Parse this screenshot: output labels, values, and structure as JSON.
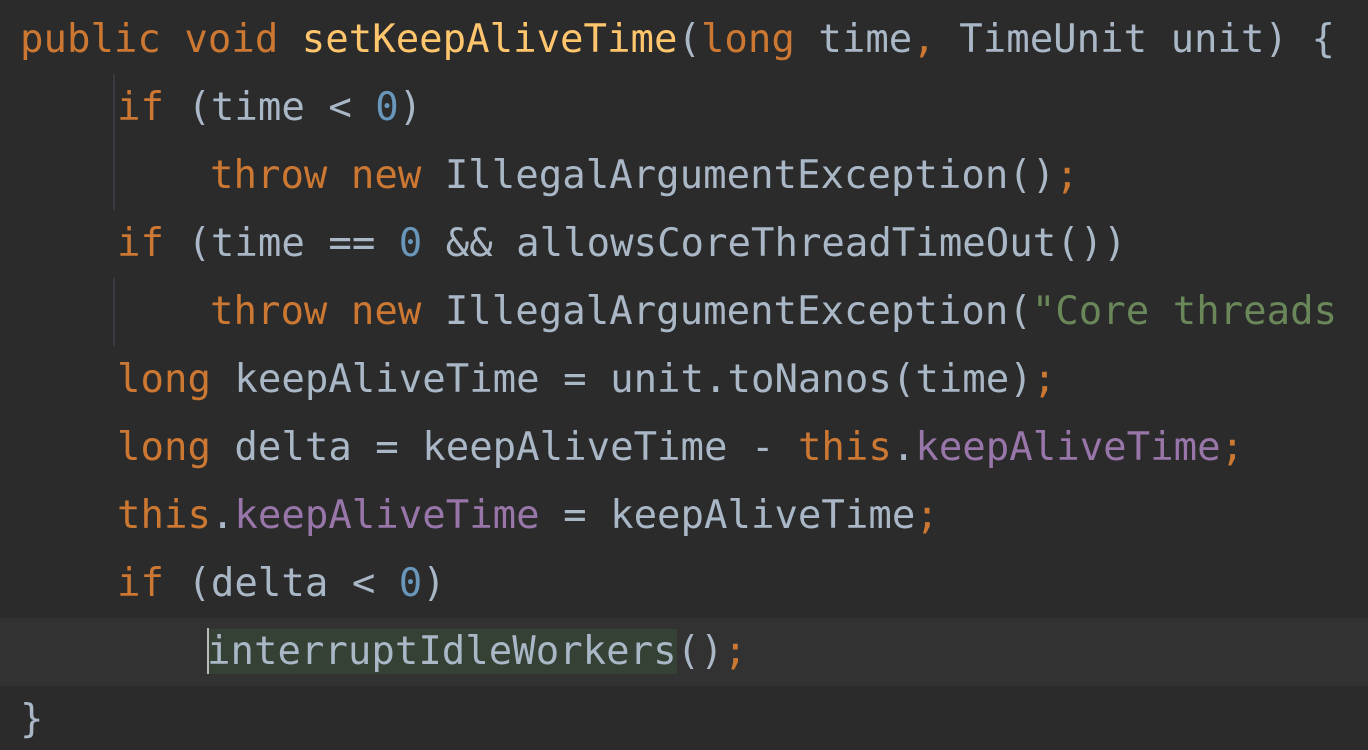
{
  "editor": {
    "language": "Java",
    "colors": {
      "background": "#2b2b2b",
      "current_line": "#323232",
      "keyword": "#cc7832",
      "method_declaration": "#ffc66d",
      "number": "#6897bb",
      "field": "#9876aa",
      "string": "#6a8759",
      "plain": "#a9b7c6",
      "usage_highlight": "#344134"
    },
    "lines": [
      {
        "tokens": {
          "public": "public",
          "void": "void",
          "name": "setKeepAliveTime",
          "paren_open": "(",
          "long": "long",
          "p1": "time",
          "comma": ",",
          "type": "TimeUnit",
          "p2": "unit",
          "close": ") {"
        }
      },
      {
        "tokens": {
          "if": "if",
          "cond_open": "(time < ",
          "zero": "0",
          "cond_close": ")"
        }
      },
      {
        "tokens": {
          "throw": "throw",
          "new": "new",
          "call": "IllegalArgumentException()",
          "semi": ";"
        }
      },
      {
        "tokens": {
          "if": "if",
          "cond_open": "(time == ",
          "zero": "0",
          "cond_rest": " && allowsCoreThreadTimeOut())"
        }
      },
      {
        "tokens": {
          "throw": "throw",
          "new": "new",
          "call": "IllegalArgumentException(",
          "string": "\"Core threads"
        }
      },
      {
        "tokens": {
          "long": "long",
          "rest": "keepAliveTime = unit.toNanos(time)",
          "semi": ";"
        }
      },
      {
        "tokens": {
          "long": "long",
          "rest": "delta = keepAliveTime - ",
          "this": "this",
          "dot": ".",
          "field": "keepAliveTime",
          "semi": ";"
        }
      },
      {
        "tokens": {
          "this": "this",
          "dot": ".",
          "field": "keepAliveTime",
          "rest": " = keepAliveTime",
          "semi": ";"
        }
      },
      {
        "tokens": {
          "if": "if",
          "cond_open": "(delta < ",
          "zero": "0",
          "cond_close": ")"
        }
      },
      {
        "tokens": {
          "call": "interruptIdleWorkers",
          "parens": "()",
          "semi": ";"
        }
      },
      {
        "tokens": {
          "brace": "}"
        }
      }
    ]
  }
}
